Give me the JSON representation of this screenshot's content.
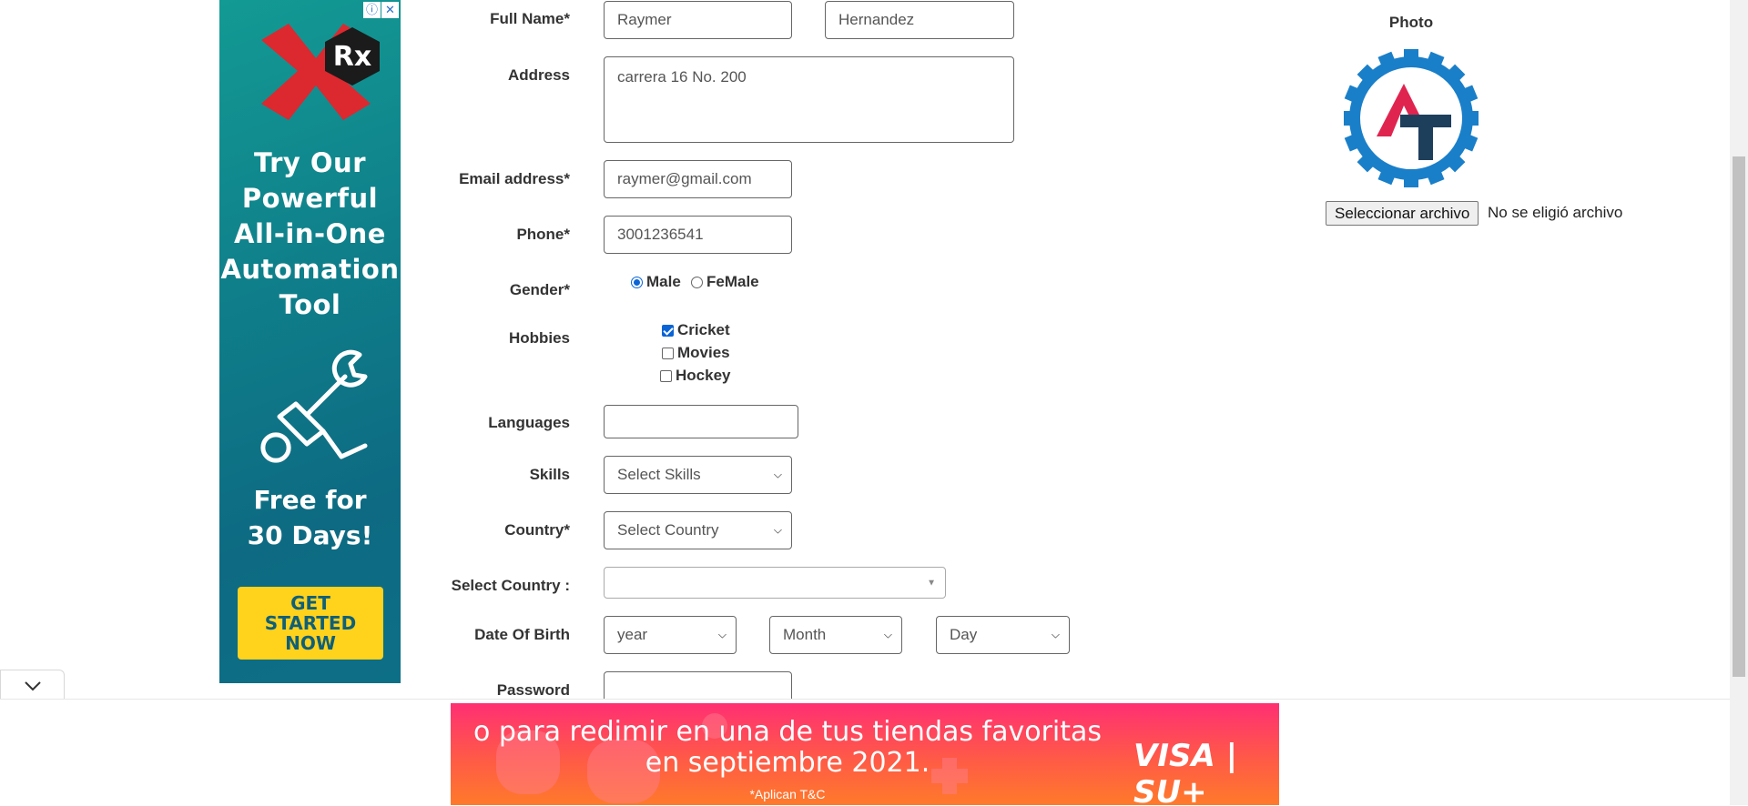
{
  "left_ad": {
    "badge": "Rx",
    "info_icon": "info-icon",
    "close_icon": "close-icon",
    "headline_lines": [
      "Try Our",
      "Powerful",
      "All-in-One",
      "Automation",
      "Tool"
    ],
    "sub_lines": [
      "Free for",
      "30 Days!"
    ],
    "cta_lines": [
      "GET",
      "STARTED",
      "NOW"
    ],
    "colors": {
      "background": "#0f7f8a",
      "cta": "#ffd21c",
      "logo_red": "#e8232a"
    }
  },
  "form": {
    "full_name": {
      "label": "Full Name*",
      "first_value": "Raymer",
      "last_value": "Hernandez"
    },
    "address": {
      "label": "Address",
      "value": "carrera 16 No. 200"
    },
    "email": {
      "label": "Email address*",
      "value": "raymer@gmail.com"
    },
    "phone": {
      "label": "Phone*",
      "value": "3001236541"
    },
    "gender": {
      "label": "Gender*",
      "options": [
        {
          "label": "Male",
          "checked": true
        },
        {
          "label": "FeMale",
          "checked": false
        }
      ]
    },
    "hobbies": {
      "label": "Hobbies",
      "options": [
        {
          "label": "Cricket",
          "checked": true
        },
        {
          "label": "Movies",
          "checked": false
        },
        {
          "label": "Hockey",
          "checked": false
        }
      ]
    },
    "languages": {
      "label": "Languages",
      "value": ""
    },
    "skills": {
      "label": "Skills",
      "selected": "Select Skills"
    },
    "country": {
      "label": "Country*",
      "selected": "Select Country"
    },
    "select_country": {
      "label": "Select Country :",
      "selected": ""
    },
    "dob": {
      "label": "Date Of Birth",
      "year": "year",
      "month": "Month",
      "day": "Day"
    },
    "password": {
      "label": "Password",
      "value": ""
    }
  },
  "photo": {
    "label": "Photo",
    "button_label": "Seleccionar archivo",
    "status": "No se eligió archivo",
    "logo_colors": {
      "gear": "#1a7fc9",
      "a": "#e02450",
      "t": "#1d3f5c"
    }
  },
  "bottom_ad": {
    "line1": "o para redimir en una de tus tiendas favoritas",
    "line2": "en septiembre 2021.",
    "tnc": "*Aplican T&C",
    "brand": "VISA | SU+",
    "collapse_icon": "chevron-down-icon"
  }
}
